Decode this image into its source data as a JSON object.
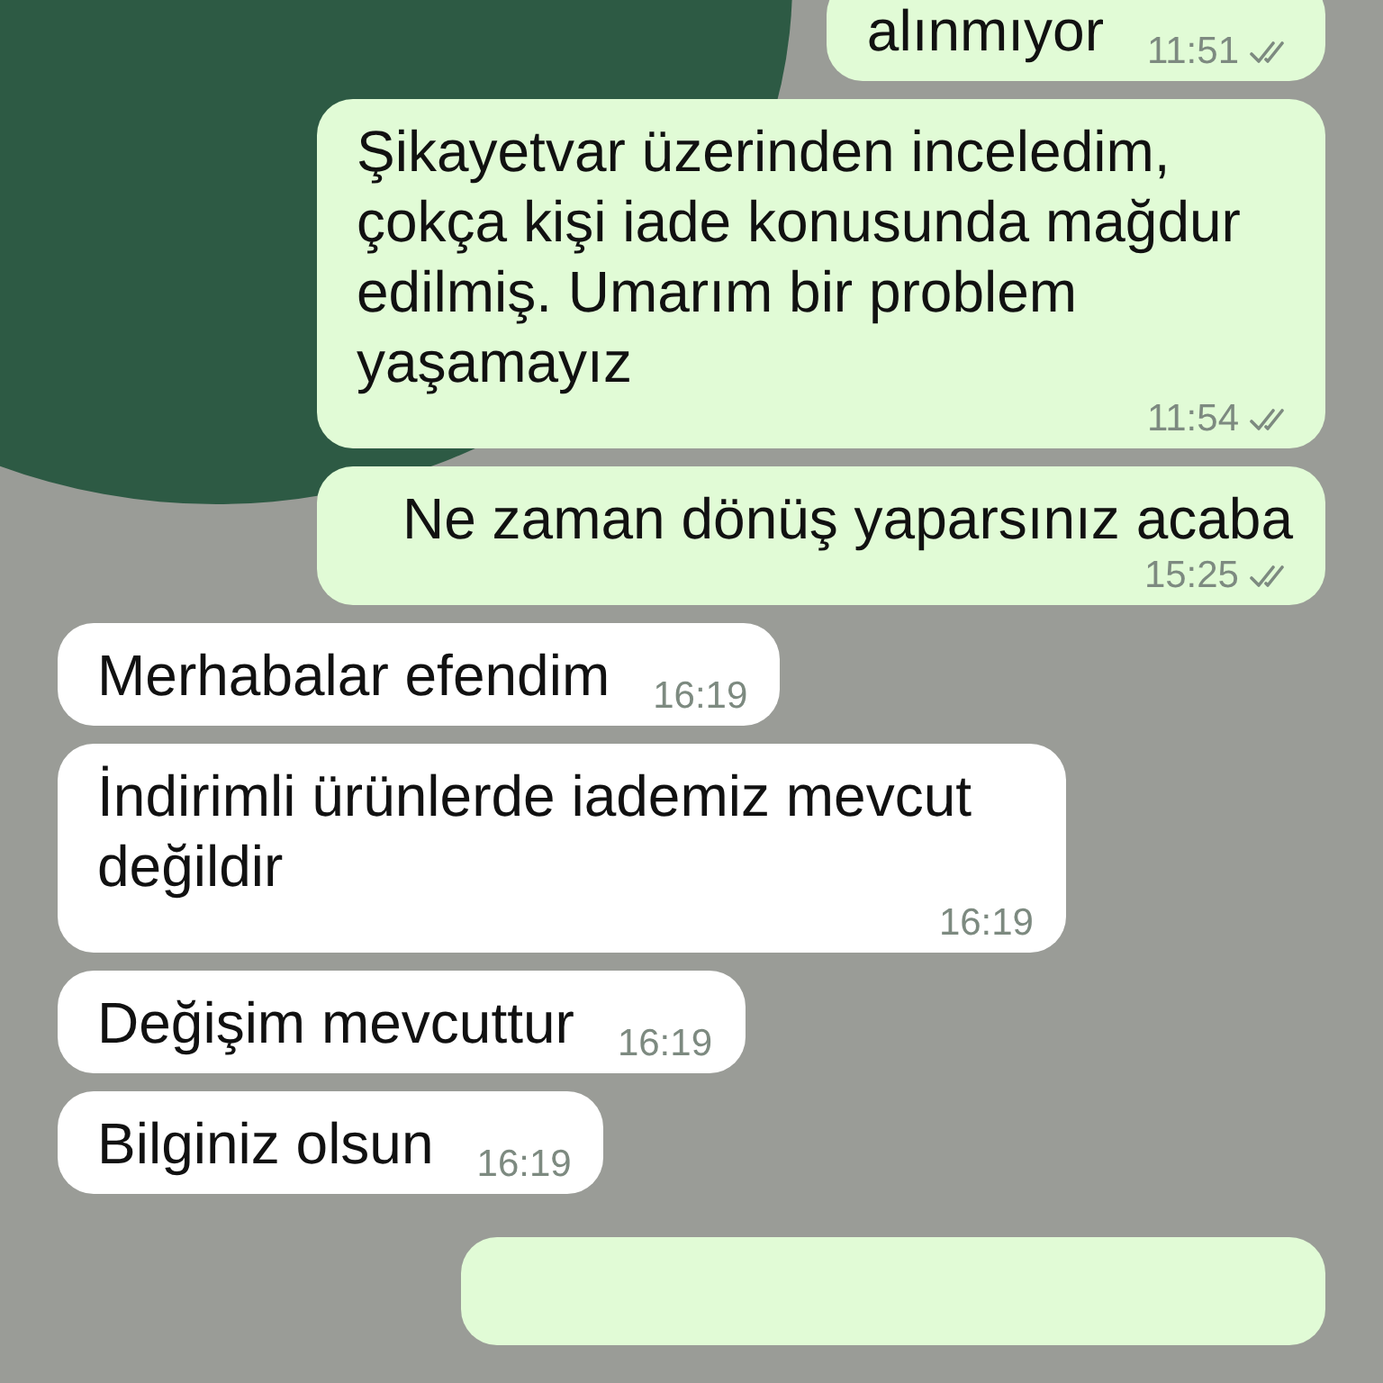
{
  "messages": [
    {
      "outgoing": true,
      "text": "alınmıyor",
      "time": "11:51",
      "read": false
    },
    {
      "outgoing": true,
      "text": "Şikayetvar üzerinden inceledim, çokça kişi iade konusunda mağdur edilmiş. Umarım bir problem yaşamayız",
      "time": "11:54",
      "read": false
    },
    {
      "outgoing": true,
      "text": "Ne zaman dönüş yaparsınız acaba",
      "time": "15:25",
      "read": false
    },
    {
      "outgoing": false,
      "text": "Merhabalar efendim",
      "time": "16:19"
    },
    {
      "outgoing": false,
      "text": "İndirimli ürünlerde iademiz mevcut değildir",
      "time": "16:19"
    },
    {
      "outgoing": false,
      "text": "Değişim mevcuttur",
      "time": "16:19"
    },
    {
      "outgoing": false,
      "text": "Bilginiz olsun",
      "time": "16:19"
    },
    {
      "outgoing": true
    }
  ]
}
